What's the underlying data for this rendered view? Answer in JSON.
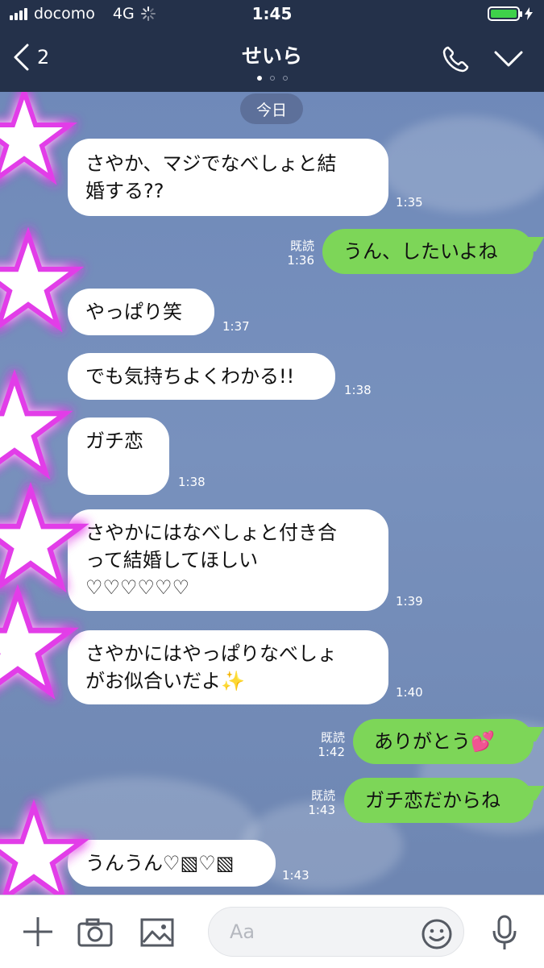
{
  "status_bar": {
    "carrier": "docomo",
    "network": "4G",
    "time": "1:45",
    "battery_level": 1.0
  },
  "header": {
    "back_count": "2",
    "title": "せいら",
    "page_dots": 3,
    "active_dot": 0
  },
  "chat": {
    "date_label": "今日",
    "messages": [
      {
        "side": "left",
        "text": "さやか、マジでなべしょと結\n婚する??",
        "time": "1:35"
      },
      {
        "side": "right",
        "text": "うん、したいよね",
        "read": "既読",
        "time": "1:36"
      },
      {
        "side": "left",
        "text": "やっぱり笑",
        "time": "1:37"
      },
      {
        "side": "left",
        "text": "でも気持ちよくわかる!!",
        "time": "1:38"
      },
      {
        "side": "left",
        "text": "ガチ恋",
        "time": "1:38"
      },
      {
        "side": "left",
        "text": "さやかにはなべしょと付き合\nって結婚してほしい\n♡♡♡♡♡♡",
        "time": "1:39"
      },
      {
        "side": "left",
        "text": "さやかにはやっぱりなべしょ\nがお似合いだよ✨",
        "time": "1:40"
      },
      {
        "side": "right",
        "text": "ありがとう💕",
        "read": "既読",
        "time": "1:42"
      },
      {
        "side": "right",
        "text": "ガチ恋だからね",
        "read": "既読",
        "time": "1:43"
      },
      {
        "side": "left",
        "text": "うんうん♡▧♡▧",
        "time": "1:43"
      }
    ]
  },
  "input_bar": {
    "placeholder": "Aa",
    "icons": [
      "plus-icon",
      "camera-icon",
      "image-icon",
      "smiley-icon",
      "microphone-icon"
    ]
  },
  "colors": {
    "header_bg": "#24314a",
    "chat_bg": "#7891bd",
    "sent_bubble": "#7dd658",
    "received_bubble": "#ffffff",
    "star_glow": "#e23ee8"
  }
}
